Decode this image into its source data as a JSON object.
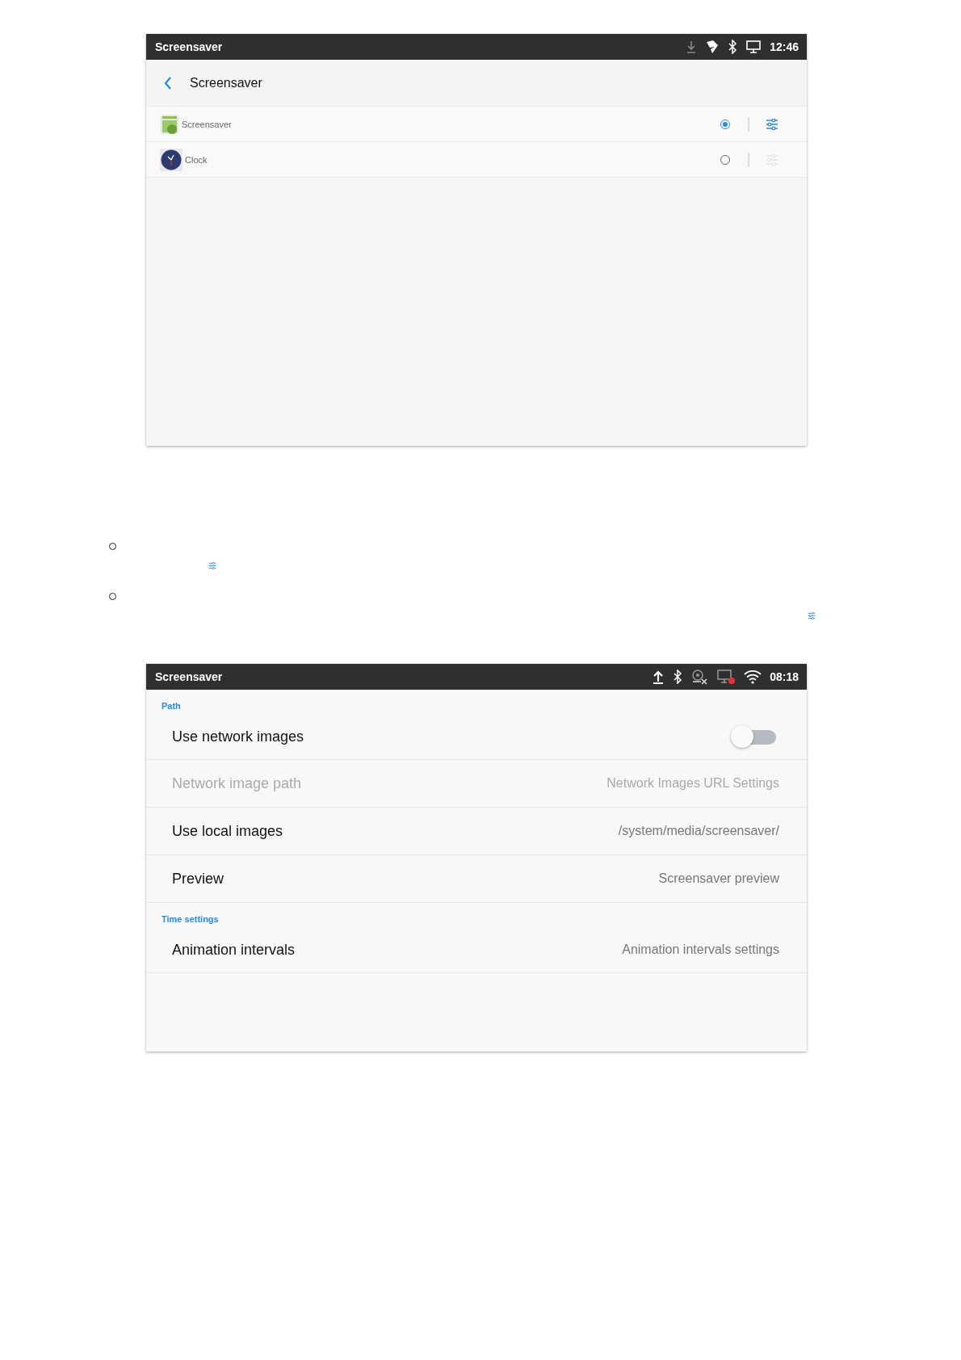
{
  "picker_screen": {
    "status_bar": {
      "title": "Screensaver",
      "time": "12:46"
    },
    "header": {
      "title": "Screensaver"
    },
    "items": [
      {
        "label": "Screensaver",
        "selected": true,
        "settings_disabled": false
      },
      {
        "label": "Clock",
        "selected": false,
        "settings_disabled": true
      }
    ]
  },
  "notes": [
    {
      "kind": "indented"
    },
    {
      "kind": "trailing"
    }
  ],
  "settings_screen": {
    "status_bar": {
      "title": "Screensaver",
      "time": "08:18"
    },
    "sections": [
      {
        "title": "Path",
        "rows": [
          {
            "kind": "switch",
            "label": "Use network images",
            "on": false
          },
          {
            "kind": "value",
            "label": "Network image path",
            "value": "Network Images URL Settings",
            "disabled": true
          },
          {
            "kind": "value",
            "label": "Use local images",
            "value": "/system/media/screensaver/",
            "disabled": false
          },
          {
            "kind": "value",
            "label": "Preview",
            "value": "Screensaver preview",
            "disabled": false
          }
        ]
      },
      {
        "title": "Time settings",
        "rows": [
          {
            "kind": "value",
            "label": "Animation intervals",
            "value": "Animation intervals settings",
            "disabled": false
          }
        ]
      }
    ]
  }
}
